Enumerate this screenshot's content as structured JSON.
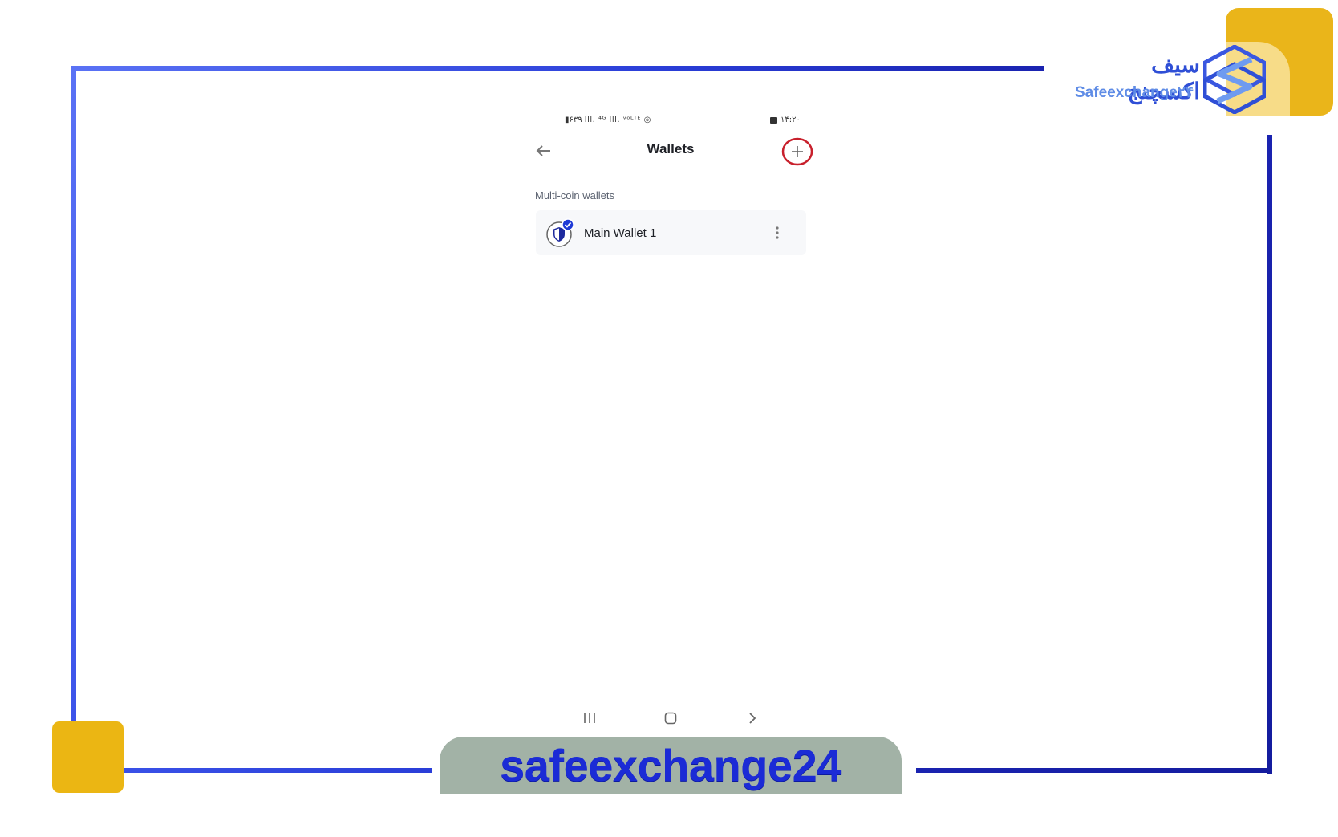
{
  "brand": {
    "name_fa": "سیف اکسچنج",
    "name_en": "Safeexchange۲۴",
    "banner_text": "safeexchange24",
    "colors": {
      "primary_blue": "#2f4fd6",
      "accent_yellow": "#ebb613",
      "banner_bg": "#a2b2a6"
    }
  },
  "status_bar": {
    "left": "▮۶۳۹ lll. ⁴ᴳ lll. ᵛᵒᴸᵀᴱ ◎",
    "time": "۱۴:۲۰"
  },
  "header": {
    "back_icon": "arrow-left-icon",
    "title": "Wallets",
    "add_icon": "plus-icon",
    "add_highlight_color": "#c8202c"
  },
  "section": {
    "label": "Multi-coin wallets"
  },
  "wallets": [
    {
      "name": "Main Wallet 1",
      "icon": "shield-check-icon",
      "menu_icon": "more-vertical-icon"
    }
  ],
  "nav_bar": {
    "recents_icon": "recents-icon",
    "home_icon": "home-icon",
    "back_icon": "chevron-right-icon"
  }
}
